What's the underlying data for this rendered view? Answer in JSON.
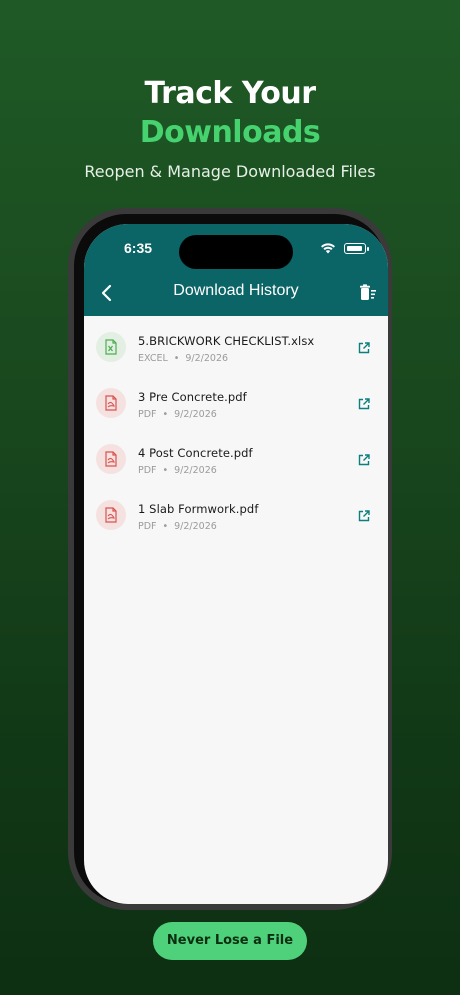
{
  "hero": {
    "title": "Track Your",
    "highlight": "Downloads",
    "subtitle": "Reopen & Manage Downloaded Files"
  },
  "status_bar": {
    "time": "6:35",
    "icons": [
      "wifi-icon",
      "battery-icon"
    ]
  },
  "app_header": {
    "title": "Download History",
    "back_icon": "chevron-left-icon",
    "clear_icon": "trash-list-icon"
  },
  "files": [
    {
      "name": "5.BRICKWORK CHECKLIST.xlsx",
      "type": "EXCEL",
      "date": "9/2/2026",
      "icon": "excel-file-icon"
    },
    {
      "name": "3 Pre Concrete.pdf",
      "type": "PDF",
      "date": "9/2/2026",
      "icon": "pdf-file-icon"
    },
    {
      "name": "4 Post Concrete.pdf",
      "type": "PDF",
      "date": "9/2/2026",
      "icon": "pdf-file-icon"
    },
    {
      "name": "1 Slab Formwork.pdf",
      "type": "PDF",
      "date": "9/2/2026",
      "icon": "pdf-file-icon"
    }
  ],
  "meta_separator": "•",
  "cta": {
    "label": "Never Lose a File"
  },
  "colors": {
    "header": "#0b6466",
    "accent_green": "#46d36f",
    "excel_green": "#4caf50",
    "pdf_red": "#d9534f",
    "open_icon": "#0b7f80"
  }
}
